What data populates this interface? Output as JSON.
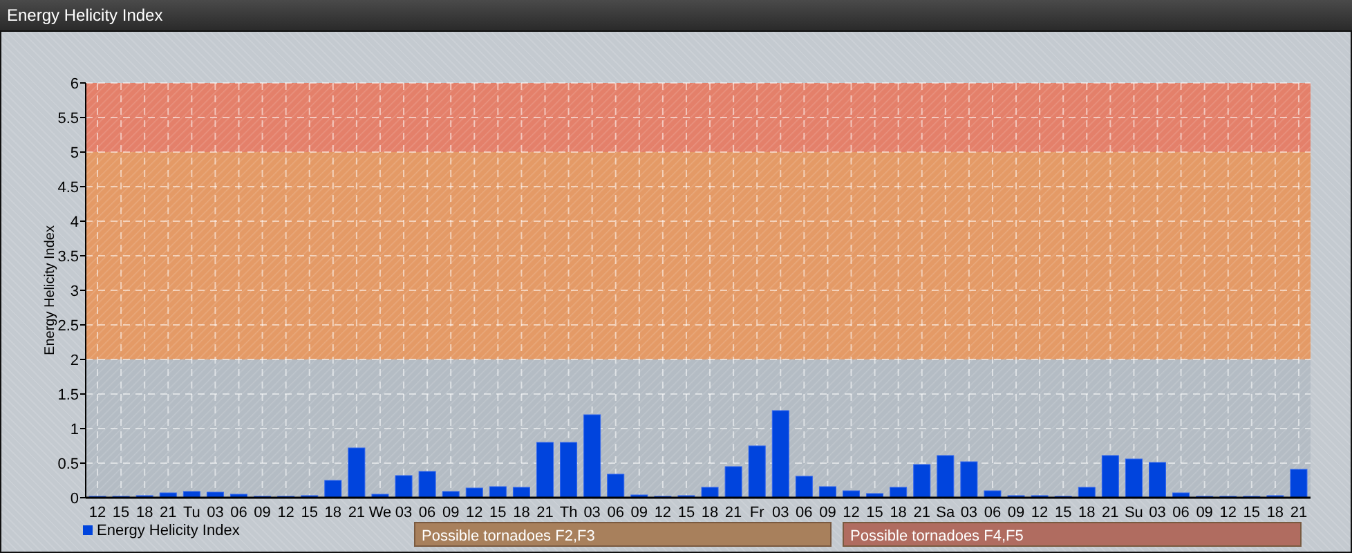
{
  "window": {
    "title": "Energy Helicity Index"
  },
  "chart": {
    "chart_data": {
      "type": "bar",
      "ylabel": "Energy Helicity Index",
      "categories": [
        "12",
        "15",
        "18",
        "21",
        "Tu",
        "03",
        "06",
        "09",
        "12",
        "15",
        "18",
        "21",
        "We",
        "03",
        "06",
        "09",
        "12",
        "15",
        "18",
        "21",
        "Th",
        "03",
        "06",
        "09",
        "12",
        "15",
        "18",
        "21",
        "Fr",
        "03",
        "06",
        "09",
        "12",
        "15",
        "18",
        "21",
        "Sa",
        "03",
        "06",
        "09",
        "12",
        "15",
        "18",
        "21",
        "Su",
        "03",
        "06",
        "09",
        "12",
        "15",
        "18",
        "21"
      ],
      "series": [
        {
          "name": "Energy Helicity Index",
          "color": "#0044dd",
          "values": [
            0.02,
            0.02,
            0.03,
            0.07,
            0.09,
            0.08,
            0.05,
            0.02,
            0.02,
            0.03,
            0.25,
            0.72,
            0.05,
            0.32,
            0.38,
            0.09,
            0.14,
            0.16,
            0.15,
            0.8,
            0.8,
            1.2,
            0.34,
            0.04,
            0.02,
            0.03,
            0.15,
            0.45,
            0.75,
            1.26,
            0.31,
            0.16,
            0.1,
            0.06,
            0.15,
            0.48,
            0.61,
            0.52,
            0.1,
            0.03,
            0.03,
            0.02,
            0.15,
            0.61,
            0.56,
            0.51,
            0.07,
            0.02,
            0.02,
            0.02,
            0.03,
            0.41
          ]
        }
      ],
      "ylim": [
        0,
        6
      ],
      "yticks": [
        0,
        0.5,
        1,
        1.5,
        2,
        2.5,
        3,
        3.5,
        4,
        4.5,
        5,
        5.5,
        6
      ],
      "grid": true,
      "bands": [
        {
          "axis": "y",
          "from": 2,
          "to": 5,
          "color": "#e49a66"
        },
        {
          "axis": "y",
          "from": 5,
          "to": 6,
          "color": "#e4806a"
        }
      ]
    },
    "band_legend": [
      {
        "label": "Possible tornadoes F2,F3",
        "color": "#a8805c"
      },
      {
        "label": "Possible tornadoes F4,F5",
        "color": "#b06c60"
      }
    ]
  }
}
